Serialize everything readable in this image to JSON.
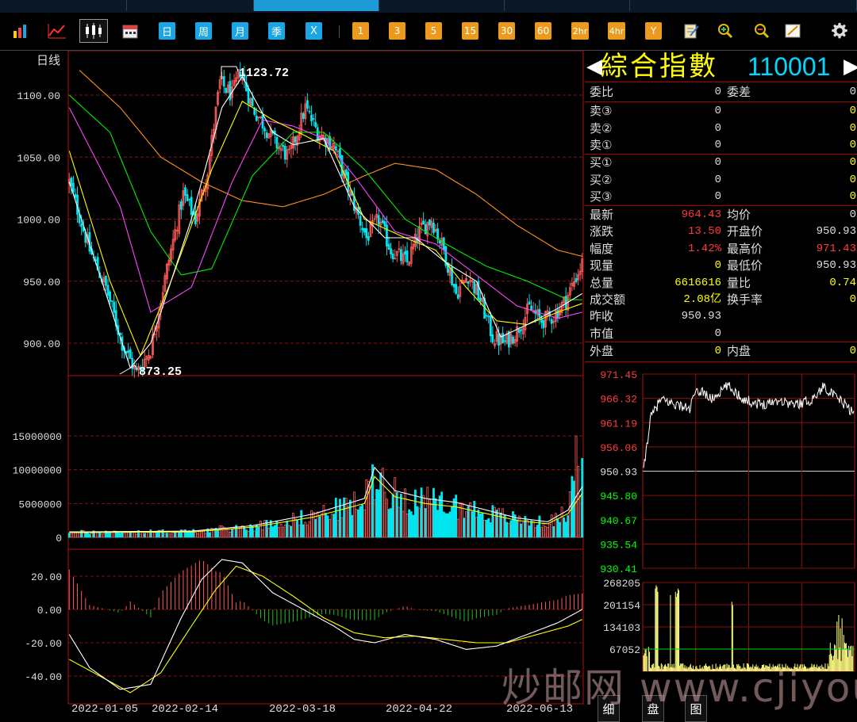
{
  "toolbar": {
    "period_buttons": [
      "日",
      "周",
      "月",
      "季",
      "X"
    ],
    "minute_buttons": [
      "1",
      "3",
      "5",
      "15",
      "30",
      "60",
      "2hr",
      "4hr",
      "Y"
    ]
  },
  "main_chart": {
    "period_label": "日线",
    "high_label": "1123.72",
    "low_label": "873.25",
    "y_ticks": [
      "1100.00",
      "1050.00",
      "1000.00",
      "950.00",
      "900.00"
    ],
    "y_tick_values": [
      1100,
      1050,
      1000,
      950,
      900
    ]
  },
  "volume_chart": {
    "y_ticks": [
      "15000000",
      "10000000",
      "5000000",
      "0"
    ]
  },
  "macd_chart": {
    "y_ticks": [
      "20.00",
      "0.00",
      "-20.00",
      "-40.00"
    ]
  },
  "x_axis_labels": [
    "2022-01-05",
    "2022-02-14",
    "2022-03-18",
    "2022-04-22",
    "2022-06-13"
  ],
  "quote": {
    "name": "綜合指數",
    "code": "110001",
    "weibi_label": "委比",
    "weibi_value": "0",
    "weicha_label": "委差",
    "weicha_value": "0",
    "sell": [
      {
        "label": "卖③",
        "price": "0",
        "vol": "0"
      },
      {
        "label": "卖②",
        "price": "0",
        "vol": "0"
      },
      {
        "label": "卖①",
        "price": "0",
        "vol": "0"
      }
    ],
    "buy": [
      {
        "label": "买①",
        "price": "0",
        "vol": "0"
      },
      {
        "label": "买②",
        "price": "0",
        "vol": "0"
      },
      {
        "label": "买③",
        "price": "0",
        "vol": "0"
      }
    ],
    "stats_left": [
      {
        "label": "最新",
        "value": "964.43",
        "color": "#ff3b3b"
      },
      {
        "label": "涨跌",
        "value": "13.50",
        "color": "#ff3b3b"
      },
      {
        "label": "幅度",
        "value": "1.42%",
        "color": "#ff3b3b"
      },
      {
        "label": "现量",
        "value": "0",
        "color": "#ffff00"
      },
      {
        "label": "总量",
        "value": "6616616",
        "color": "#ffff00"
      },
      {
        "label": "成交额",
        "value": "2.08亿",
        "color": "#ffff00"
      },
      {
        "label": "昨收",
        "value": "950.93",
        "color": "#dddddd"
      },
      {
        "label": "市值",
        "value": "0",
        "color": "#dddddd"
      }
    ],
    "stats_right": [
      {
        "label": "均价",
        "value": "0",
        "color": "#dddddd"
      },
      {
        "label": "开盘价",
        "value": "950.93",
        "color": "#dddddd"
      },
      {
        "label": "最高价",
        "value": "971.43",
        "color": "#ff3b3b"
      },
      {
        "label": "最低价",
        "value": "950.93",
        "color": "#dddddd"
      },
      {
        "label": "量比",
        "value": "0.74",
        "color": "#ffff00"
      },
      {
        "label": "换手率",
        "value": "0",
        "color": "#ffff00"
      }
    ],
    "waipan_label": "外盘",
    "waipan_value": "0",
    "neipan_label": "内盘",
    "neipan_value": "0"
  },
  "intraday": {
    "price_ticks": [
      "971.45",
      "966.32",
      "961.19",
      "956.06",
      "950.93",
      "945.80",
      "940.67",
      "935.54",
      "930.41"
    ],
    "vol_ticks": [
      "268205",
      "201154",
      "134103",
      "67052"
    ]
  },
  "bottom_tabs": [
    "细",
    "盘",
    "图"
  ],
  "watermark": "炒邮网 www.cjiyou.net",
  "colors": {
    "up": "#ff5a5a",
    "down": "#00e5ee",
    "ma5": "#ffffff",
    "ma10": "#ffff00",
    "ma20": "#ff44ff",
    "ma30": "#00ee00",
    "ma60": "#ff9020",
    "grid": "#8a1010"
  },
  "chart_data": {
    "type": "candlestick",
    "price_key_points": [
      {
        "x": 0,
        "y": 1030
      },
      {
        "x": 10,
        "y": 975
      },
      {
        "x": 18,
        "y": 945
      },
      {
        "x": 26,
        "y": 900
      },
      {
        "x": 33,
        "y": 876
      },
      {
        "x": 40,
        "y": 895
      },
      {
        "x": 48,
        "y": 960
      },
      {
        "x": 56,
        "y": 1020
      },
      {
        "x": 62,
        "y": 1000
      },
      {
        "x": 68,
        "y": 1040
      },
      {
        "x": 74,
        "y": 1110
      },
      {
        "x": 80,
        "y": 1100
      },
      {
        "x": 84,
        "y": 1120
      },
      {
        "x": 90,
        "y": 1090
      },
      {
        "x": 96,
        "y": 1075
      },
      {
        "x": 102,
        "y": 1060
      },
      {
        "x": 108,
        "y": 1050
      },
      {
        "x": 116,
        "y": 1090
      },
      {
        "x": 122,
        "y": 1070
      },
      {
        "x": 130,
        "y": 1060
      },
      {
        "x": 138,
        "y": 1020
      },
      {
        "x": 146,
        "y": 985
      },
      {
        "x": 152,
        "y": 1000
      },
      {
        "x": 158,
        "y": 975
      },
      {
        "x": 166,
        "y": 965
      },
      {
        "x": 172,
        "y": 990
      },
      {
        "x": 178,
        "y": 1000
      },
      {
        "x": 184,
        "y": 975
      },
      {
        "x": 190,
        "y": 940
      },
      {
        "x": 196,
        "y": 955
      },
      {
        "x": 202,
        "y": 935
      },
      {
        "x": 208,
        "y": 905
      },
      {
        "x": 214,
        "y": 900
      },
      {
        "x": 220,
        "y": 910
      },
      {
        "x": 226,
        "y": 928
      },
      {
        "x": 232,
        "y": 918
      },
      {
        "x": 238,
        "y": 922
      },
      {
        "x": 244,
        "y": 935
      },
      {
        "x": 248,
        "y": 950
      },
      {
        "x": 252,
        "y": 964
      }
    ],
    "ma5": [
      [
        0,
        1030
      ],
      [
        30,
        880
      ],
      [
        40,
        900
      ],
      [
        60,
        1000
      ],
      [
        75,
        1090
      ],
      [
        85,
        1115
      ],
      [
        100,
        1070
      ],
      [
        110,
        1060
      ],
      [
        125,
        1065
      ],
      [
        140,
        1010
      ],
      [
        155,
        985
      ],
      [
        170,
        985
      ],
      [
        185,
        965
      ],
      [
        200,
        950
      ],
      [
        212,
        905
      ],
      [
        225,
        915
      ],
      [
        240,
        928
      ],
      [
        252,
        940
      ]
    ],
    "ma10": [
      [
        0,
        1055
      ],
      [
        20,
        950
      ],
      [
        35,
        890
      ],
      [
        50,
        950
      ],
      [
        70,
        1040
      ],
      [
        85,
        1095
      ],
      [
        100,
        1080
      ],
      [
        115,
        1068
      ],
      [
        130,
        1055
      ],
      [
        145,
        1000
      ],
      [
        165,
        985
      ],
      [
        180,
        975
      ],
      [
        195,
        945
      ],
      [
        210,
        918
      ],
      [
        225,
        915
      ],
      [
        240,
        925
      ],
      [
        252,
        932
      ]
    ],
    "ma20": [
      [
        0,
        1090
      ],
      [
        25,
        1010
      ],
      [
        40,
        925
      ],
      [
        60,
        945
      ],
      [
        80,
        1030
      ],
      [
        95,
        1080
      ],
      [
        110,
        1075
      ],
      [
        125,
        1065
      ],
      [
        140,
        1035
      ],
      [
        160,
        990
      ],
      [
        180,
        980
      ],
      [
        200,
        955
      ],
      [
        220,
        930
      ],
      [
        240,
        920
      ],
      [
        252,
        925
      ]
    ],
    "ma30": [
      [
        0,
        1100
      ],
      [
        20,
        1070
      ],
      [
        40,
        990
      ],
      [
        55,
        955
      ],
      [
        70,
        960
      ],
      [
        90,
        1035
      ],
      [
        110,
        1070
      ],
      [
        125,
        1070
      ],
      [
        145,
        1040
      ],
      [
        165,
        1000
      ],
      [
        185,
        980
      ],
      [
        205,
        962
      ],
      [
        225,
        950
      ],
      [
        245,
        935
      ],
      [
        252,
        935
      ]
    ],
    "ma60": [
      [
        5,
        1120
      ],
      [
        25,
        1090
      ],
      [
        45,
        1050
      ],
      [
        65,
        1030
      ],
      [
        85,
        1015
      ],
      [
        105,
        1010
      ],
      [
        125,
        1020
      ],
      [
        145,
        1035
      ],
      [
        160,
        1045
      ],
      [
        180,
        1040
      ],
      [
        200,
        1020
      ],
      [
        220,
        995
      ],
      [
        240,
        975
      ],
      [
        252,
        970
      ]
    ],
    "volume_ma": [
      [
        0,
        700000
      ],
      [
        60,
        800000
      ],
      [
        90,
        1500000
      ],
      [
        120,
        3000000
      ],
      [
        145,
        5000000
      ],
      [
        150,
        9000000
      ],
      [
        160,
        6000000
      ],
      [
        175,
        5000000
      ],
      [
        190,
        4500000
      ],
      [
        205,
        3500000
      ],
      [
        220,
        2500000
      ],
      [
        235,
        2000000
      ],
      [
        245,
        3500000
      ],
      [
        252,
        6500000
      ]
    ],
    "macd_dif": [
      [
        0,
        -15
      ],
      [
        10,
        -35
      ],
      [
        25,
        -48
      ],
      [
        40,
        -45
      ],
      [
        55,
        -5
      ],
      [
        65,
        18
      ],
      [
        75,
        30
      ],
      [
        85,
        28
      ],
      [
        100,
        10
      ],
      [
        115,
        0
      ],
      [
        130,
        -10
      ],
      [
        140,
        -18
      ],
      [
        150,
        -20
      ],
      [
        165,
        -15
      ],
      [
        180,
        -18
      ],
      [
        195,
        -24
      ],
      [
        210,
        -22
      ],
      [
        225,
        -15
      ],
      [
        240,
        -8
      ],
      [
        252,
        0
      ]
    ],
    "macd_dea": [
      [
        0,
        -30
      ],
      [
        15,
        -40
      ],
      [
        30,
        -50
      ],
      [
        45,
        -38
      ],
      [
        60,
        -10
      ],
      [
        72,
        12
      ],
      [
        82,
        26
      ],
      [
        95,
        20
      ],
      [
        110,
        8
      ],
      [
        125,
        -5
      ],
      [
        140,
        -14
      ],
      [
        155,
        -17
      ],
      [
        170,
        -16
      ],
      [
        185,
        -18
      ],
      [
        200,
        -20
      ],
      [
        215,
        -20
      ],
      [
        230,
        -15
      ],
      [
        245,
        -10
      ],
      [
        252,
        -6
      ]
    ],
    "intraday_price": [
      [
        0,
        950.93
      ],
      [
        8,
        962
      ],
      [
        20,
        966
      ],
      [
        40,
        965
      ],
      [
        55,
        964
      ],
      [
        60,
        967
      ],
      [
        70,
        968
      ],
      [
        80,
        966
      ],
      [
        100,
        969
      ],
      [
        120,
        966
      ],
      [
        140,
        965
      ],
      [
        160,
        966
      ],
      [
        180,
        965
      ],
      [
        200,
        966
      ],
      [
        215,
        969
      ],
      [
        225,
        967
      ],
      [
        240,
        965
      ],
      [
        250,
        963
      ]
    ],
    "intraday_volume_avg": 67052
  }
}
